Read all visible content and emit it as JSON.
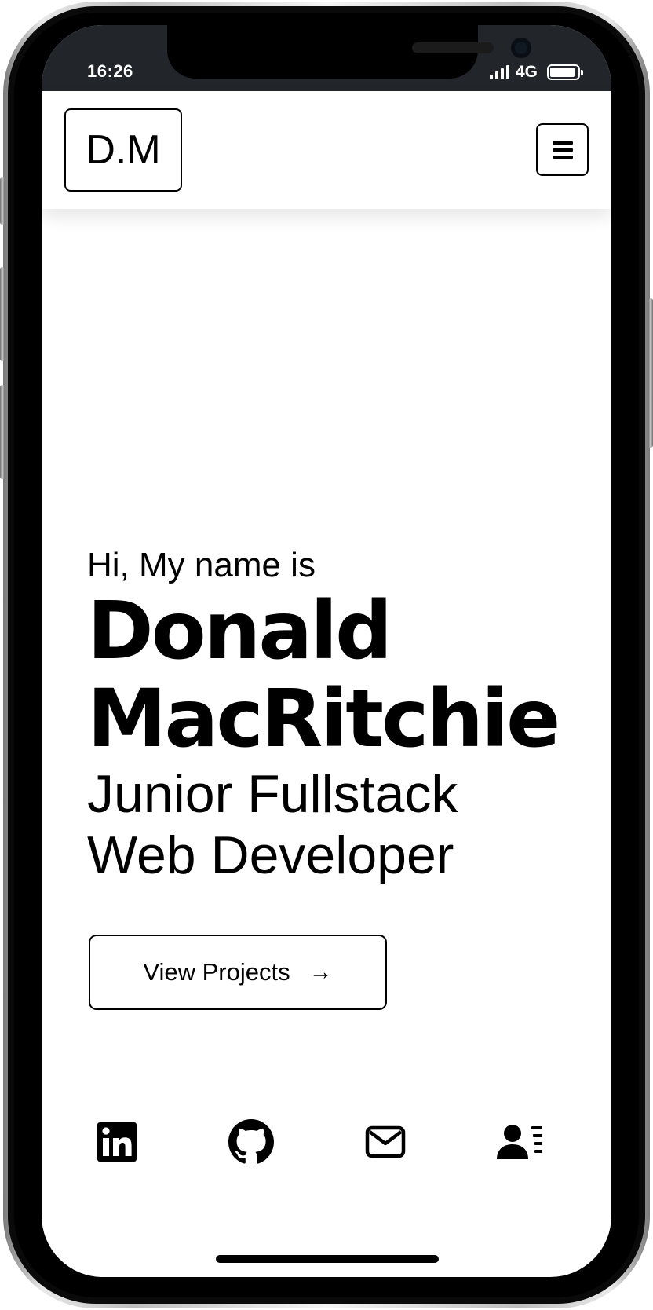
{
  "status_bar": {
    "time": "16:26",
    "network": "4G",
    "battery_level": 0.9
  },
  "navbar": {
    "logo_text": "D.M",
    "menu_icon": "hamburger-icon"
  },
  "hero": {
    "greeting": "Hi, My name is",
    "first_name": "Donald",
    "last_name": "MacRitchie",
    "role_line_1": "Junior Fullstack",
    "role_line_2": "Web Developer",
    "cta_label": "View Projects",
    "cta_arrow": "→"
  },
  "socials": [
    {
      "icon": "linkedin-icon"
    },
    {
      "icon": "github-icon"
    },
    {
      "icon": "mail-icon"
    },
    {
      "icon": "contact-card-icon"
    }
  ],
  "colors": {
    "status_bar_bg": "#22262b",
    "text": "#000000",
    "background": "#ffffff"
  }
}
